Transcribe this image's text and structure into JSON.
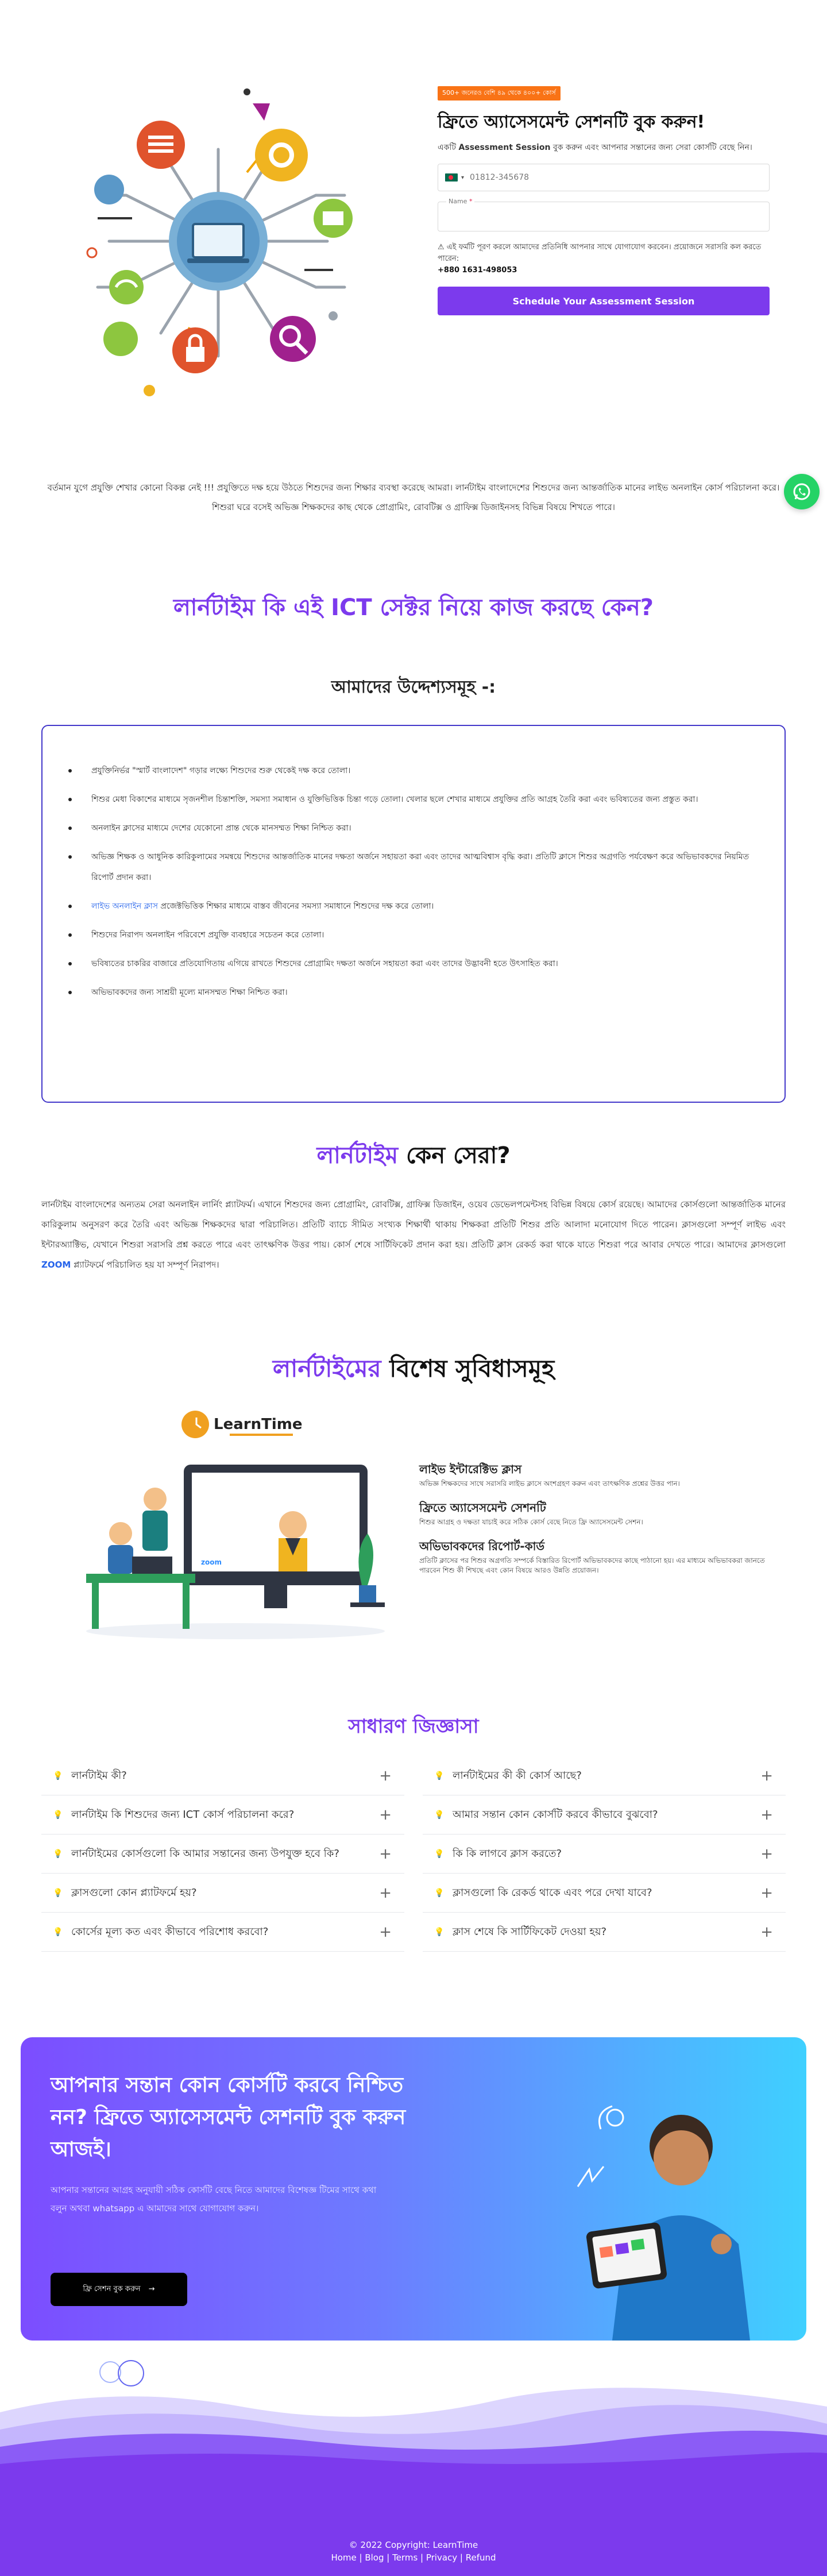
{
  "hero": {
    "badge": "500+ জনেরও বেশি ৪৯ থেকে ৪০০+ কোর্স",
    "title": "ফ্রিতে অ্যাসেসমেন্ট সেশনটি বুক করুন!",
    "desc_prefix": "একটি",
    "desc_bold": "Assessment Session",
    "desc_rest": "বুক করুন এবং আপনার সন্তানের জন্য সেরা কোর্সটি বেছে নিন।",
    "phone_placeholder": "01812-345678",
    "name_label": "Name",
    "name_required": "*",
    "note": "⚠ এই ফর্মটি পূরণ করলে আমাদের প্রতিনিধি আপনার সাথে যোগাযোগ করবেন। প্রয়োজনে সরাসরি কল করতে পারেন:",
    "phone_number": "+880 1631-498053",
    "button": "Schedule Your Assessment Session"
  },
  "intro": "বর্তমান যুগে প্রযুক্তি শেখার কোনো বিকল্প নেই !!! প্রযুক্তিতে দক্ষ হয়ে উঠতে শিশুদের জন্য শিক্ষার ব্যবস্থা করেছে আমরা। লার্নটাইম বাংলাদেশের শিশুদের জন্য আন্তর্জাতিক মানের লাইভ অনলাইন কোর্স পরিচালনা করে। শিশুরা ঘরে বসেই অভিজ্ঞ শিক্ষকদের কাছ থেকে প্রোগ্রামিং, রোবটিক্স ও গ্রাফিক্স ডিজাইনসহ বিভিন্ন বিষয়ে শিখতে পারে।",
  "section_why": "লার্নটাইম কি এই ICT সেক্টর নিয়ে কাজ করছে কেন?",
  "section_benefit": "আমাদের উদ্দেশ্যসমূহ -:",
  "bullets": [
    "প্রযুক্তিনির্ভর \"স্মার্ট বাংলাদেশ\" গড়ার লক্ষ্যে শিশুদের শুরু থেকেই দক্ষ করে তোলা।",
    "শিশুর মেধা বিকাশের মাধ্যমে সৃজনশীল চিন্তাশক্তি, সমস্যা সমাধান ও যুক্তিভিত্তিক চিন্তা গড়ে তোলা। খেলার ছলে শেখার মাধ্যমে প্রযুক্তির প্রতি আগ্রহ তৈরি করা এবং ভবিষ্যতের জন্য প্রস্তুত করা।",
    "অনলাইন ক্লাসের মাধ্যমে দেশের যেকোনো প্রান্ত থেকে মানসম্মত শিক্ষা নিশ্চিত করা।",
    "অভিজ্ঞ শিক্ষক ও আধুনিক কারিকুলামের সমন্বয়ে শিশুদের আন্তর্জাতিক মানের দক্ষতা অর্জনে সহায়তা করা এবং তাদের আত্মবিশ্বাস বৃদ্ধি করা। প্রতিটি ক্লাসে শিশুর অগ্রগতি পর্যবেক্ষণ করে অভিভাবকদের নিয়মিত রিপোর্ট প্রদান করা।",
    "প্রজেক্টভিত্তিক শিক্ষার মাধ্যমে বাস্তব জীবনের সমস্যা সমাধানে শিশুদের দক্ষ করে তোলা।",
    "শিশুদের নিরাপদ অনলাইন পরিবেশে প্রযুক্তি ব্যবহারে সচেতন করে তোলা।",
    "ভবিষ্যতের চাকরির বাজারে প্রতিযোগিতায় এগিয়ে রাখতে শিশুদের প্রোগ্রামিং দক্ষতা অর্জনে সহায়তা করা এবং তাদের উদ্ভাবনী হতে উৎসাহিত করা।",
    "অভিভাবকদের জন্য সাশ্রয়ী মূল্যে মানসম্মত শিক্ষা নিশ্চিত করা।"
  ],
  "bullet_link_index": 4,
  "bullet_link_text": "লাইভ অনলাইন ক্লাস",
  "about_title_highlight": "লার্নটাইম",
  "about_title_rest": "কেন সেরা?",
  "about": "লার্নটাইম বাংলাদেশের অন্যতম সেরা অনলাইন লার্নিং প্ল্যাটফর্ম। এখানে শিশুদের জন্য প্রোগ্রামিং, রোবটিক্স, গ্রাফিক্স ডিজাইন, ওয়েব ডেভেলপমেন্টসহ বিভিন্ন বিষয়ে কোর্স রয়েছে। আমাদের কোর্সগুলো আন্তর্জাতিক মানের কারিকুলাম অনুসরণ করে তৈরি এবং অভিজ্ঞ শিক্ষকদের দ্বারা পরিচালিত। প্রতিটি ব্যাচে সীমিত সংখ্যক শিক্ষার্থী থাকায় শিক্ষকরা প্রতিটি শিশুর প্রতি আলাদা মনোযোগ দিতে পারেন। ক্লাসগুলো সম্পূর্ণ লাইভ এবং ইন্টারঅ্যাক্টিভ, যেখানে শিশুরা সরাসরি প্রশ্ন করতে পারে এবং তাৎক্ষণিক উত্তর পায়। কোর্স শেষে সার্টিফিকেট প্রদান করা হয়। প্রতিটি ক্লাস রেকর্ড করা থাকে যাতে শিশুরা পরে আবার দেখতে পারে। আমাদের ক্লাসগুলো",
  "about_zoom": "ZOOM",
  "about_tail": "প্ল্যাটফর্মে পরিচালিত হয় যা সম্পূর্ণ নিরাপদ।",
  "features_title_highlight": "লার্নটাইমের",
  "features_title_rest": "বিশেষ সুবিধাসমূহ",
  "learntime_logo": "LearnTime",
  "features": [
    {
      "title": "লাইভ ইন্টারেক্টিভ ক্লাস",
      "desc": "অভিজ্ঞ শিক্ষকদের সাথে সরাসরি লাইভ ক্লাসে অংশগ্রহণ করুন এবং তাৎক্ষণিক প্রশ্নের উত্তর পান।"
    },
    {
      "title": "ফ্রিতে অ্যাসেসমেন্ট সেশনটি",
      "desc": "শিশুর আগ্রহ ও দক্ষতা যাচাই করে সঠিক কোর্স বেছে নিতে ফ্রি অ্যাসেসমেন্ট সেশন।"
    },
    {
      "title": "অভিভাবকদের রিপোর্ট-কার্ড",
      "desc": "প্রতিটি ক্লাসের পর শিশুর অগ্রগতি সম্পর্কে বিস্তারিত রিপোর্ট অভিভাবকদের কাছে পাঠানো হয়। এর মাধ্যমে অভিভাবকরা জানতে পারবেন শিশু কী শিখছে এবং কোন বিষয়ে আরও উন্নতি প্রয়োজন।"
    }
  ],
  "faq_title": "সাধারণ জিজ্ঞাসা",
  "faq_left": [
    "লার্নটাইম কী?",
    "লার্নটাইম কি শিশুদের জন্য ICT কোর্স পরিচালনা করে?",
    "লার্নটাইমের কোর্সগুলো কি আমার সন্তানের জন্য উপযুক্ত হবে কি?",
    "ক্লাসগুলো কোন প্ল্যাটফর্মে হয়?",
    "কোর্সের মূল্য কত এবং কীভাবে পরিশোধ করবো?"
  ],
  "faq_right": [
    "লার্নটাইমের কী কী কোর্স আছে?",
    "আমার সন্তান কোন কোর্সটি করবে কীভাবে বুঝবো?",
    "কি কি লাগবে ক্লাস করতে?",
    "ক্লাসগুলো কি রেকর্ড থাকে এবং পরে দেখা যাবে?",
    "ক্লাস শেষে কি সার্টিফিকেট দেওয়া হয়?"
  ],
  "promo": {
    "title": "আপনার সন্তান কোন কোর্সটি করবে নিশ্চিত নন? ফ্রিতে অ্যাসেসমেন্ট সেশনটি বুক করুন আজই।",
    "desc": "আপনার সন্তানের আগ্রহ অনুযায়ী সঠিক কোর্সটি বেছে নিতে আমাদের বিশেষজ্ঞ টিমের সাথে কথা বলুন অথবা whatsapp এ আমাদের সাথে যোগাযোগ করুন।",
    "button": "ফ্রি সেশন বুক করুন"
  },
  "footer": {
    "copyright": "© 2022 Copyright: LearnTime",
    "links": "Home | Blog | Terms | Privacy | Refund"
  },
  "colors": {
    "accent": "#7c3aed",
    "badge": "#f97316",
    "whatsapp": "#25d366",
    "link": "#2563eb"
  }
}
